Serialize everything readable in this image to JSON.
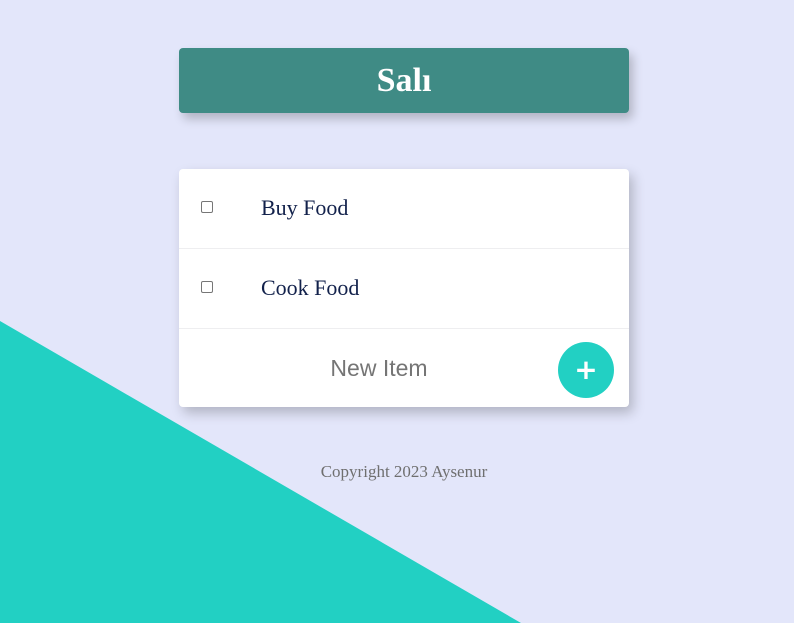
{
  "header": {
    "title": "Salı"
  },
  "todo": {
    "items": [
      {
        "label": "Buy Food",
        "checked": false
      },
      {
        "label": "Cook Food",
        "checked": false
      }
    ],
    "new_item_placeholder": "New Item",
    "add_button_label": "+"
  },
  "footer": {
    "copyright": "Copyright 2023 Aysenur"
  },
  "colors": {
    "background": "#E3E6FA",
    "accent": "#22D0C3",
    "header_bg": "#3F8B85",
    "item_text": "#12214B"
  }
}
